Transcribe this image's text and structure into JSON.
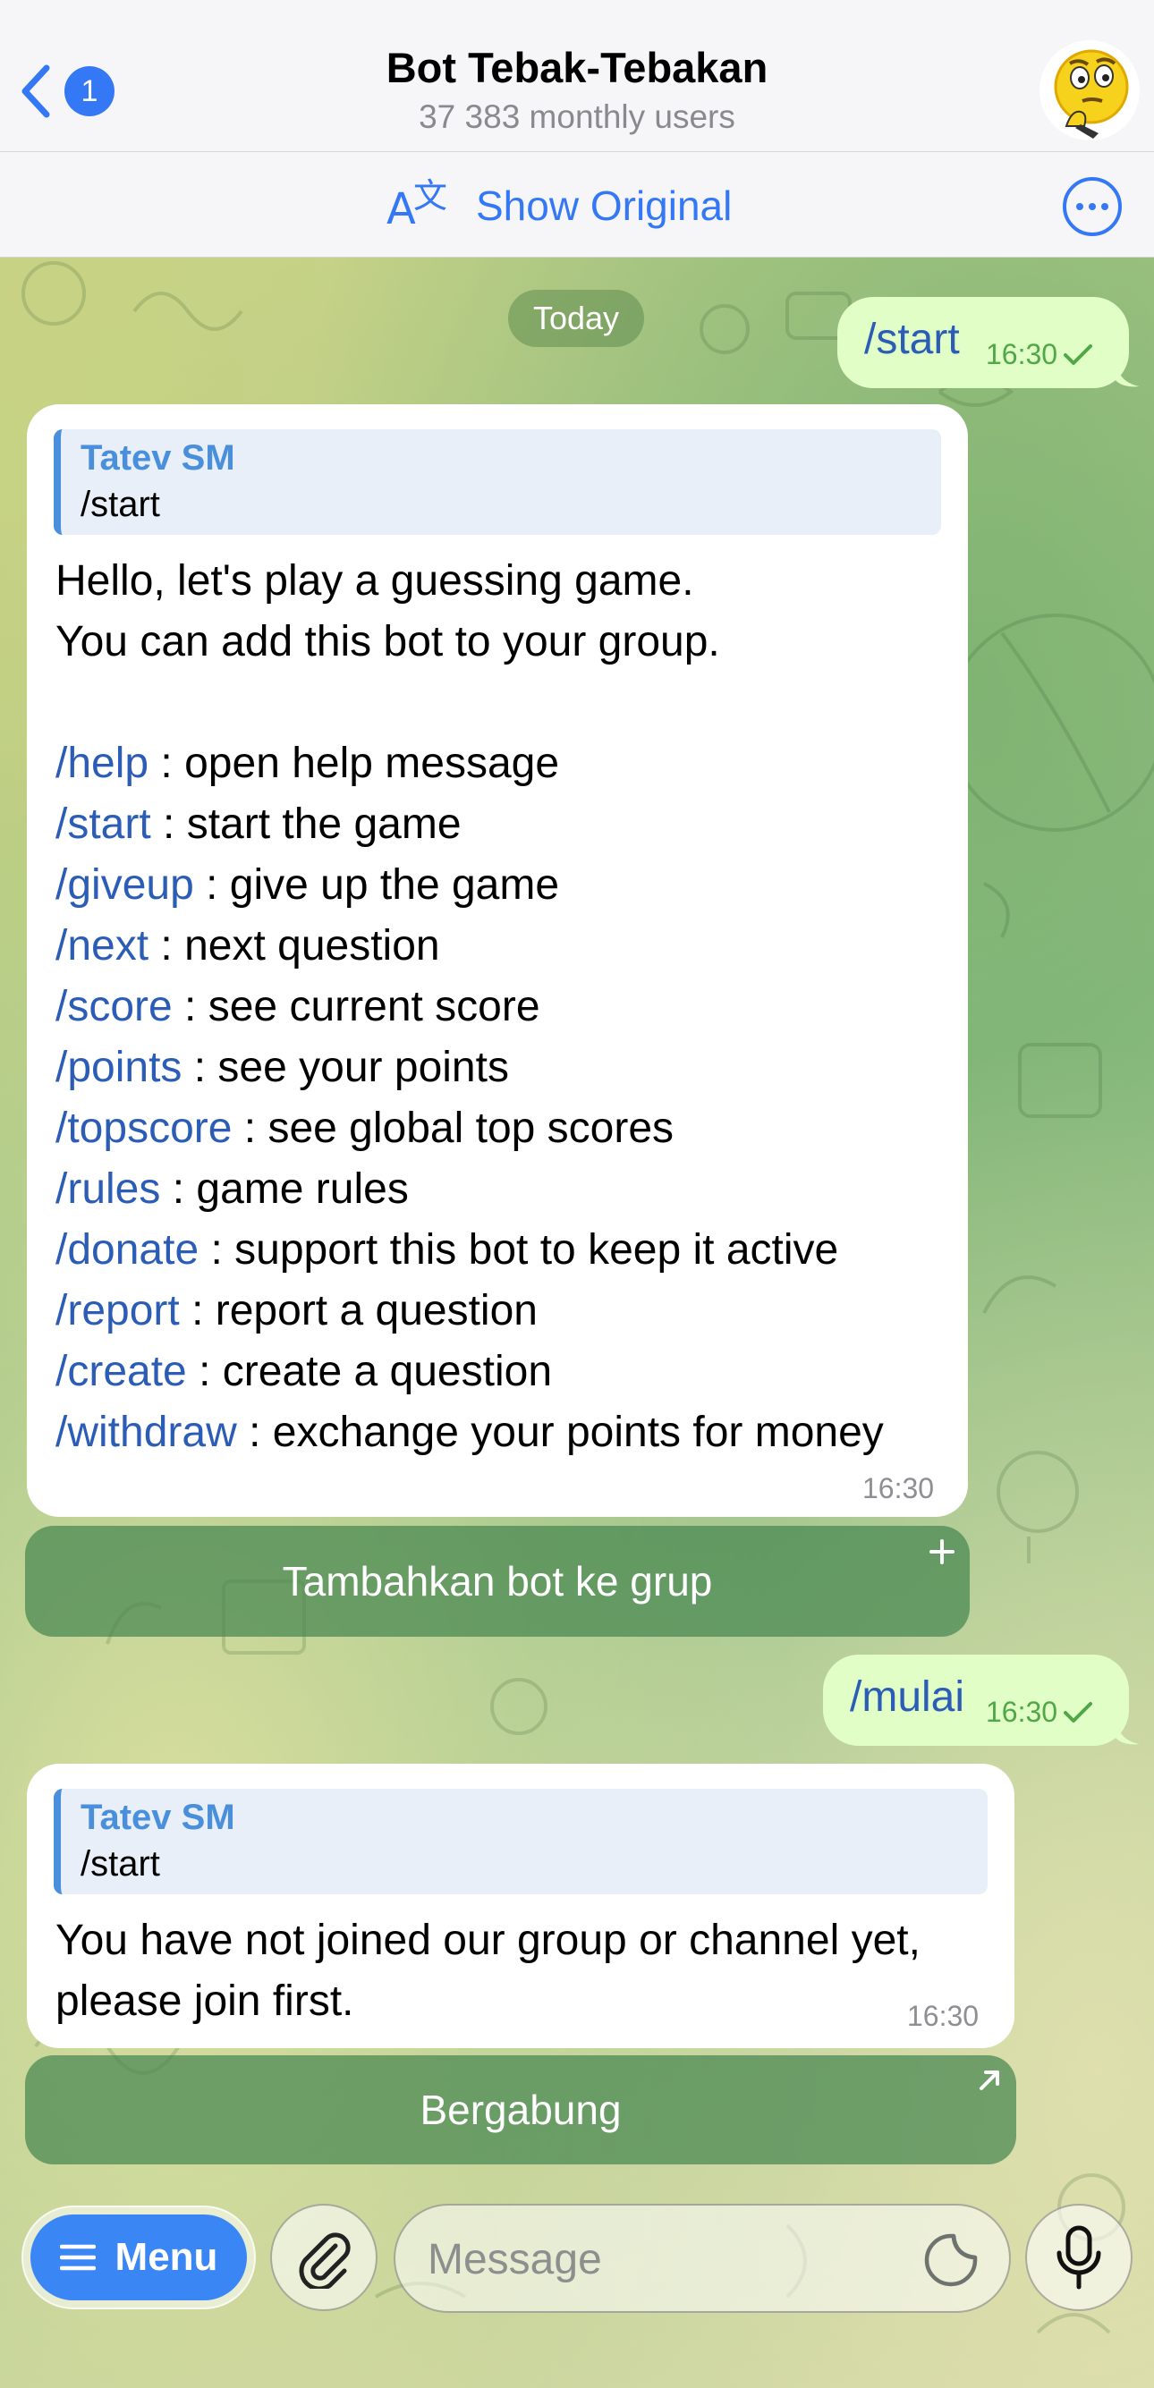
{
  "header": {
    "back_badge": "1",
    "title": "Bot Tebak-Tebakan",
    "subtitle": "37 383 monthly users"
  },
  "translate_bar": {
    "label": "Show Original"
  },
  "chat": {
    "date_label": "Today",
    "messages": [
      {
        "direction": "out",
        "text": "/start",
        "time": "16:30"
      },
      {
        "direction": "in",
        "reply_name": "Tatev SM",
        "reply_text": "/start",
        "intro_line1": "Hello, let's play a guessing game.",
        "intro_line2": "You can add this bot to your group.",
        "commands": [
          {
            "cmd": "/help",
            "desc": " : open help message"
          },
          {
            "cmd": "/start",
            "desc": " : start the game"
          },
          {
            "cmd": "/giveup",
            "desc": " : give up the game"
          },
          {
            "cmd": "/next",
            "desc": " : next question"
          },
          {
            "cmd": "/score",
            "desc": " : see current score"
          },
          {
            "cmd": "/points",
            "desc": " : see your points"
          },
          {
            "cmd": "/topscore",
            "desc": " : see global top scores"
          },
          {
            "cmd": "/rules",
            "desc": " : game rules"
          },
          {
            "cmd": "/donate",
            "desc": " : support this bot to keep it active"
          },
          {
            "cmd": "/report",
            "desc": " : report a question"
          },
          {
            "cmd": "/create",
            "desc": " : create a question"
          },
          {
            "cmd": "/withdraw",
            "desc": " : exchange your points for money"
          }
        ],
        "time": "16:30",
        "button_label": "Tambahkan bot ke grup"
      },
      {
        "direction": "out",
        "text": "/mulai",
        "time": "16:30"
      },
      {
        "direction": "in",
        "reply_name": "Tatev SM",
        "reply_text": "/start",
        "line1": "You have not joined our group or channel yet,",
        "line2": "please join first.",
        "time": "16:30",
        "button_label": "Bergabung"
      }
    ]
  },
  "input_bar": {
    "menu_label": "Menu",
    "placeholder": "Message"
  },
  "colors": {
    "accent": "#3478f6",
    "command_link": "#2b5cb6",
    "outgoing_bubble": "#e1fec6",
    "outgoing_time": "#4fa748",
    "keyboard_button": "#468750"
  },
  "icons": [
    "back-chevron-icon",
    "bot-avatar-icon",
    "translate-icon",
    "more-icon",
    "read-check-icon",
    "plus-icon",
    "external-link-arrow-icon",
    "menu-lines-icon",
    "attach-paperclip-icon",
    "sticker-icon",
    "microphone-icon"
  ]
}
